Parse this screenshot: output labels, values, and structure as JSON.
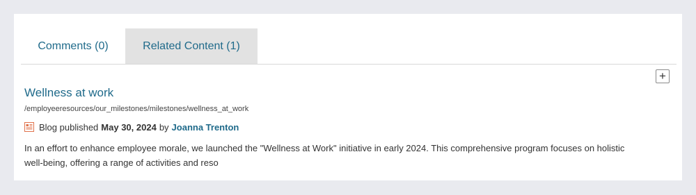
{
  "tabs": [
    {
      "label": "Comments (0)"
    },
    {
      "label": "Related Content (1)"
    }
  ],
  "toolbar": {
    "add_label": "+"
  },
  "item": {
    "title": "Wellness at work",
    "path": "/employeeresources/our_milestones/milestones/wellness_at_work",
    "icon": "blog-post-icon",
    "meta_prefix": "Blog published",
    "date": "May 30, 2024",
    "by": "by",
    "author": "Joanna Trenton",
    "description": "In an effort to enhance employee morale, we launched the \"Wellness at Work\" initiative in early 2024. This comprehensive program focuses on holistic well-being, offering a range of activities and reso"
  },
  "colors": {
    "link": "#1f6a8a",
    "active_tab_bg": "#e2e2e2",
    "page_bg": "#e9eaef",
    "icon_accent": "#e0734c"
  }
}
